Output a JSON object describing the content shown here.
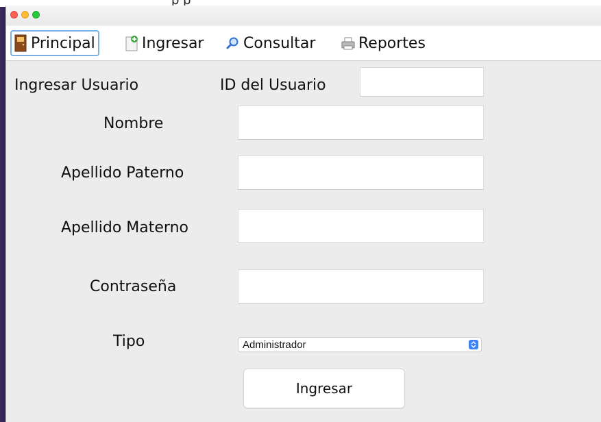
{
  "window": {
    "title_partial": "p  p"
  },
  "menu": {
    "items": [
      {
        "label": "Principal",
        "icon": "door-icon"
      },
      {
        "label": "Ingresar",
        "icon": "add-document-icon"
      },
      {
        "label": "Consultar",
        "icon": "magnifier-icon"
      },
      {
        "label": "Reportes",
        "icon": "printer-icon"
      }
    ]
  },
  "form": {
    "heading": "Ingresar Usuario",
    "id_label": "ID del Usuario",
    "id_value": "",
    "nombre_label": "Nombre",
    "nombre_value": "",
    "apellido_paterno_label": "Apellido Paterno",
    "apellido_paterno_value": "",
    "apellido_materno_label": "Apellido Materno",
    "apellido_materno_value": "",
    "contrasena_label": "Contraseña",
    "contrasena_value": "",
    "tipo_label": "Tipo",
    "tipo_selected": "Administrador",
    "submit_label": "Ingresar"
  },
  "colors": {
    "accent": "#3b82f6",
    "active_tab_border": "#7ab0e6"
  }
}
